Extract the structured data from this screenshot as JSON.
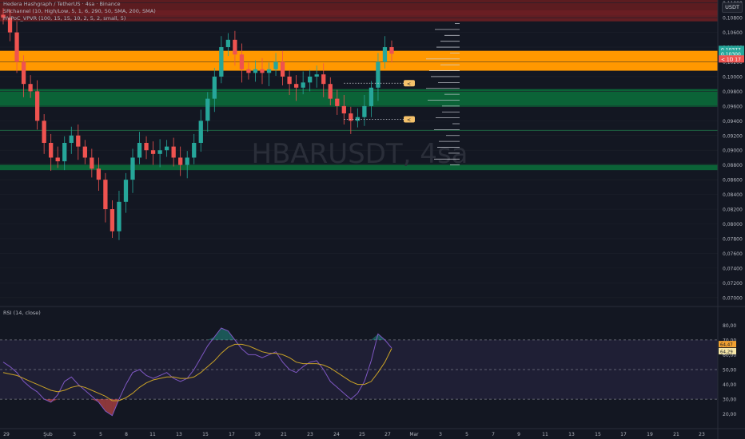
{
  "header": {
    "title": "Hedera Hashgraph / TetherUS · 4sa · Binance",
    "indicator1": "SRchannel (10, High/Low, 5, 1, 6, 290, 50, SMA, 200, SMA)",
    "indicator2": "HVPoC_VPVR (100, 15, 15, 10, 2, 5, 2, small, 5)",
    "currency": "USDT"
  },
  "watermark": "HBARUSDT, 4sa",
  "colors": {
    "background": "#131722",
    "up": "#26a69a",
    "down": "#ef5350",
    "resistance_zone": "#6b1f24",
    "orange_zone": "#ff9800",
    "support_zone": "#0b6b3a",
    "rsi_line": "#7e57c2",
    "rsi_ma": "#c9a227"
  },
  "chart_data": [
    {
      "type": "candlestick",
      "title": "Hedera Hashgraph / TetherUS · 4sa · Binance",
      "ylim": [
        0.069,
        0.1104
      ],
      "y_ticks": [
        "0,11000",
        "0,10800",
        "0,10600",
        "0,10400",
        "0,10200",
        "0,10000",
        "0,09800",
        "0,09600",
        "0,09400",
        "0,09200",
        "0,09000",
        "0,08800",
        "0,08600",
        "0,08400",
        "0,08200",
        "0,08000",
        "0,07800",
        "0,07600",
        "0,07400",
        "0,07200",
        "0,07000"
      ],
      "y_tick_values": [
        0.11,
        0.108,
        0.106,
        0.104,
        0.102,
        0.1,
        0.098,
        0.096,
        0.094,
        0.092,
        0.09,
        0.088,
        0.086,
        0.084,
        0.082,
        0.08,
        0.078,
        0.076,
        0.074,
        0.072,
        0.07
      ],
      "x_ticks": [
        "29",
        "Şub",
        "3",
        "5",
        "6",
        "8",
        "11",
        "13",
        "15",
        "17",
        "19",
        "21",
        "23",
        "24",
        "25",
        "27",
        "Mar",
        "3",
        "5",
        "7",
        "9",
        "11",
        "13",
        "15",
        "17",
        "19",
        "21",
        "23"
      ],
      "price_labels": [
        {
          "text": "0,10377",
          "value": 0.1037,
          "color": "#26a69a"
        },
        {
          "text": "0,10300",
          "value": 0.1031,
          "color": "#26a69a"
        },
        {
          "text": "< 1D 17",
          "value": 0.1024,
          "color": "#ef5350"
        }
      ],
      "zones": [
        {
          "name": "resistance",
          "from": 0.1075,
          "to": 0.109,
          "color": "#6b1f24"
        },
        {
          "name": "orange",
          "from": 0.1008,
          "to": 0.1035,
          "color": "#ff9800"
        },
        {
          "name": "support",
          "from": 0.0959,
          "to": 0.0983,
          "color": "#0b6b3a"
        },
        {
          "name": "support-low",
          "from": 0.0873,
          "to": 0.0881,
          "color": "#0b6b3a"
        }
      ],
      "hlines": [
        0.0927
      ],
      "markers": [
        {
          "value": 0.0991,
          "label": "<"
        },
        {
          "value": 0.0942,
          "label": "<"
        }
      ],
      "close": [
        0.108,
        0.106,
        0.102,
        0.099,
        0.098,
        0.094,
        0.091,
        0.089,
        0.0885,
        0.091,
        0.092,
        0.0905,
        0.089,
        0.0875,
        0.086,
        0.082,
        0.079,
        0.083,
        0.086,
        0.089,
        0.091,
        0.09,
        0.0895,
        0.09,
        0.0905,
        0.089,
        0.088,
        0.089,
        0.091,
        0.094,
        0.097,
        0.1,
        0.104,
        0.105,
        0.103,
        0.101,
        0.1005,
        0.101,
        0.1005,
        0.101,
        0.102,
        0.1,
        0.099,
        0.0985,
        0.0992,
        0.1,
        0.1003,
        0.099,
        0.097,
        0.096,
        0.095,
        0.094,
        0.0945,
        0.096,
        0.0985,
        0.102,
        0.104,
        0.1031
      ],
      "volume_profile": [
        0.1072,
        0.1064,
        0.1056,
        0.1048,
        0.104,
        0.1032,
        0.1024,
        0.1016,
        0.1008,
        0.1,
        0.0992,
        0.0984,
        0.0976,
        0.0968,
        0.096,
        0.0952,
        0.0944,
        0.0936,
        0.0928,
        0.092,
        0.0912,
        0.0904,
        0.0896,
        0.0888,
        0.088
      ]
    },
    {
      "type": "line",
      "title": "RSI (14, close)",
      "ylim": [
        15,
        85
      ],
      "y_ticks": [
        "80,00",
        "70,00",
        "60,00",
        "50,00",
        "40,00",
        "30,00",
        "20,00",
        "10,00"
      ],
      "y_tick_values": [
        80,
        70,
        60,
        50,
        40,
        30,
        20,
        10
      ],
      "levels": [
        70,
        50,
        30
      ],
      "current": {
        "rsi": "64,47",
        "ma": "64,29",
        "rsi_value": 64.47,
        "ma_value": 64.29
      },
      "series": [
        {
          "values": [
            55,
            52,
            48,
            42,
            38,
            35,
            30,
            28,
            33,
            42,
            45,
            40,
            36,
            32,
            28,
            22,
            19,
            30,
            40,
            48,
            50,
            46,
            44,
            46,
            48,
            44,
            42,
            44,
            50,
            58,
            66,
            72,
            78,
            76,
            70,
            64,
            60,
            60,
            58,
            60,
            62,
            55,
            50,
            48,
            52,
            55,
            56,
            50,
            42,
            38,
            34,
            30,
            34,
            42,
            56,
            74,
            70,
            64.47
          ]
        },
        {
          "values": [
            48,
            47,
            46,
            44,
            42,
            40,
            38,
            36,
            35,
            36,
            38,
            39,
            38,
            36,
            34,
            32,
            29,
            29,
            31,
            34,
            38,
            41,
            43,
            44,
            45,
            45,
            44,
            44,
            45,
            48,
            52,
            56,
            61,
            65,
            67,
            67,
            66,
            64,
            62,
            61,
            61,
            60,
            58,
            55,
            54,
            54,
            54,
            53,
            51,
            48,
            45,
            42,
            40,
            40,
            42,
            48,
            55,
            64.29
          ]
        }
      ]
    }
  ]
}
